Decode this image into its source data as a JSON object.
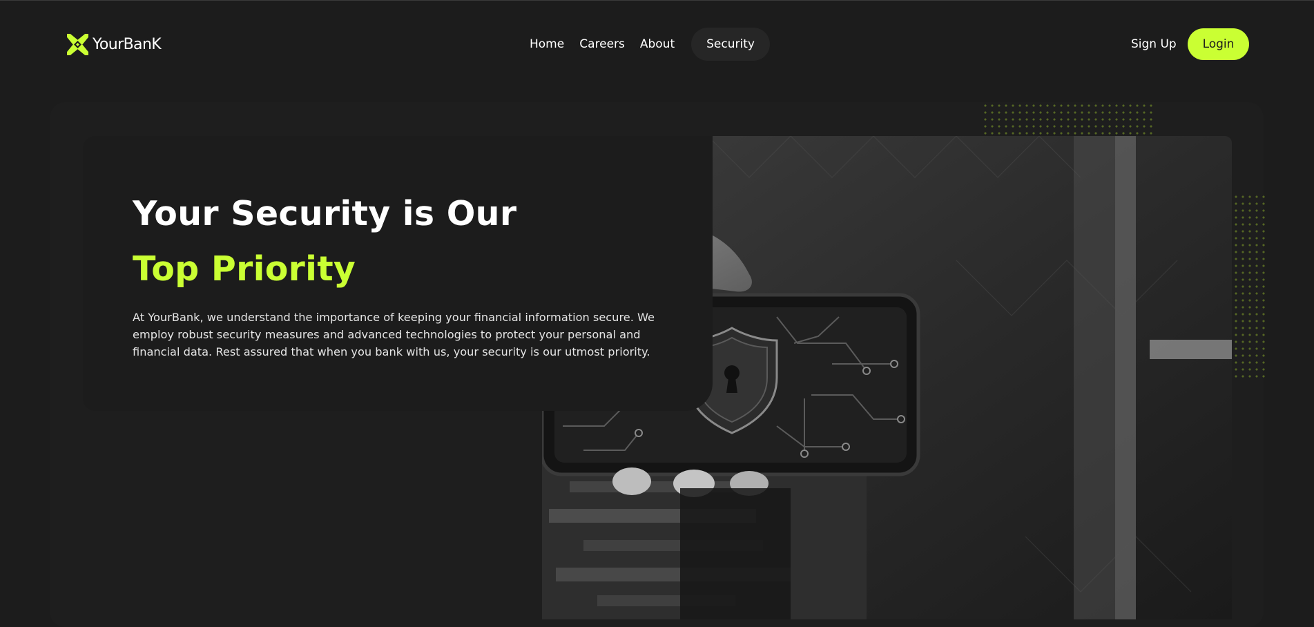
{
  "brand": {
    "name": "YourBanK",
    "accent_color": "#caff33",
    "background_color": "#1c1c1c"
  },
  "nav": {
    "items": [
      {
        "label": "Home"
      },
      {
        "label": "Careers"
      },
      {
        "label": "About"
      },
      {
        "label": "Security",
        "active": true
      }
    ]
  },
  "header_actions": {
    "signup_label": "Sign Up",
    "login_label": "Login"
  },
  "hero": {
    "title_line1": "Your Security is Our",
    "title_line2": "Top Priority",
    "description": "At YourBank, we understand the importance of keeping your financial information secure. We employ robust security measures and advanced technologies to protect your personal and financial data. Rest assured that when you bank with us, your security is our utmost priority.",
    "image_icon": "phone-lock-shield-icon"
  }
}
